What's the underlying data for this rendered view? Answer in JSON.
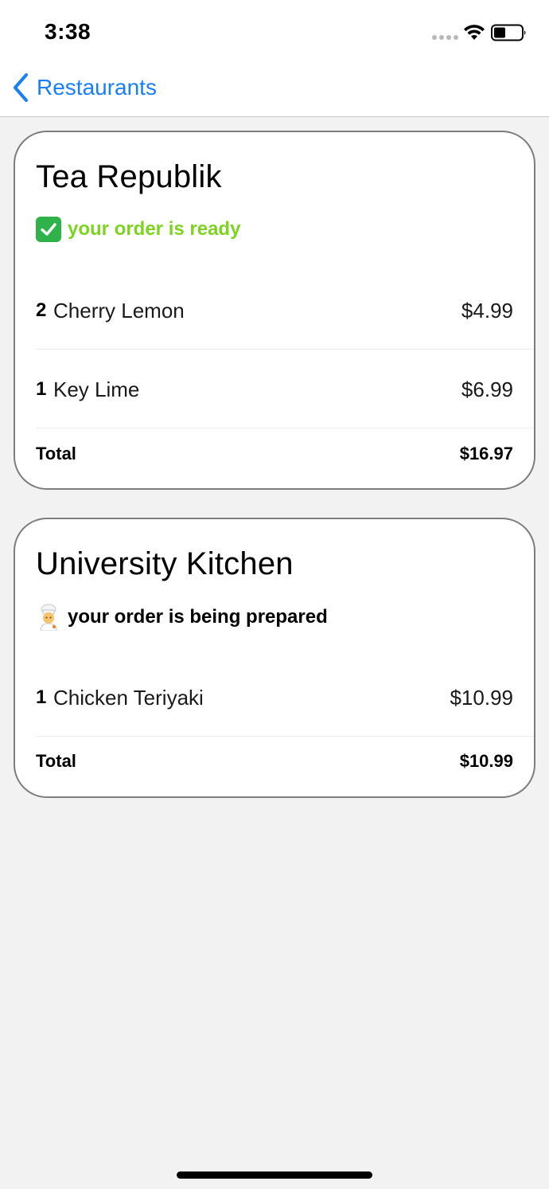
{
  "status_bar": {
    "time": "3:38"
  },
  "nav": {
    "back_label": "Restaurants"
  },
  "orders": [
    {
      "restaurant": "Tea Republik",
      "status_icon": "check-mark-emoji",
      "status_text": "your order is ready",
      "status_color": "#7ed321",
      "items": [
        {
          "qty": "2",
          "name": "Cherry Lemon",
          "price": "$4.99"
        },
        {
          "qty": "1",
          "name": "Key Lime",
          "price": "$6.99"
        }
      ],
      "total_label": "Total",
      "total": "$16.97"
    },
    {
      "restaurant": "University Kitchen",
      "status_icon": "chef-emoji",
      "status_text": "your order is being prepared",
      "status_color": "#000000",
      "items": [
        {
          "qty": "1",
          "name": "Chicken Teriyaki",
          "price": "$10.99"
        }
      ],
      "total_label": "Total",
      "total": "$10.99"
    }
  ],
  "colors": {
    "accent": "#1a7ef5",
    "ready": "#7ed321",
    "background": "#f2f2f2"
  }
}
